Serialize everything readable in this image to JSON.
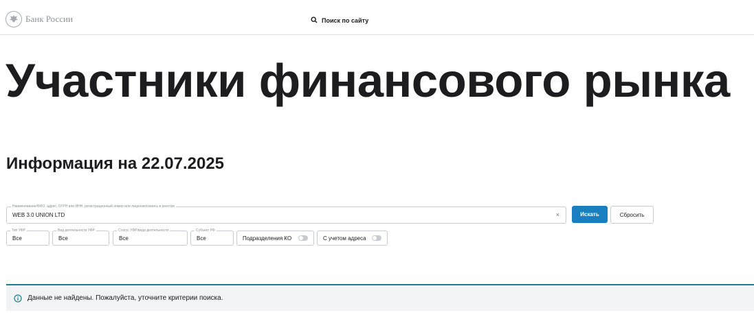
{
  "header": {
    "logo_text": "Банк России",
    "logo_icon": "eagle-emblem-icon",
    "search_label": "Поиск по сайту",
    "search_icon": "search-icon"
  },
  "page": {
    "title": "Участники финансового рынка",
    "info_heading": "Информация на 22.07.2025"
  },
  "search": {
    "legend": "Наименование/ФИО, адрес, ОГРН или ИНН, регистрационный номер или лицензия/запись в реестре",
    "value": "WEB 3.0 UNION LTD",
    "clear_glyph": "×",
    "submit_label": "Искать",
    "reset_label": "Сбросить"
  },
  "filters": [
    {
      "legend": "Тип УФР",
      "value": "Все"
    },
    {
      "legend": "Вид деятельности УФР",
      "value": "Все"
    },
    {
      "legend": "Статус УФР/вида деятельности",
      "value": "Все"
    },
    {
      "legend": "Субъект РФ",
      "value": "Все"
    }
  ],
  "toggles": [
    {
      "label": "Подразделения КО",
      "on": false
    },
    {
      "label": "С учетом адреса",
      "on": false
    }
  ],
  "alert": {
    "icon": "info-icon",
    "text": "Данные не найдены. Пожалуйста, уточните критерии поиска."
  },
  "colors": {
    "primary_button": "#1a7fc1",
    "alert_accent": "#1a7f8e",
    "alert_background": "#f2f3f4",
    "muted_text": "#8f9499"
  }
}
